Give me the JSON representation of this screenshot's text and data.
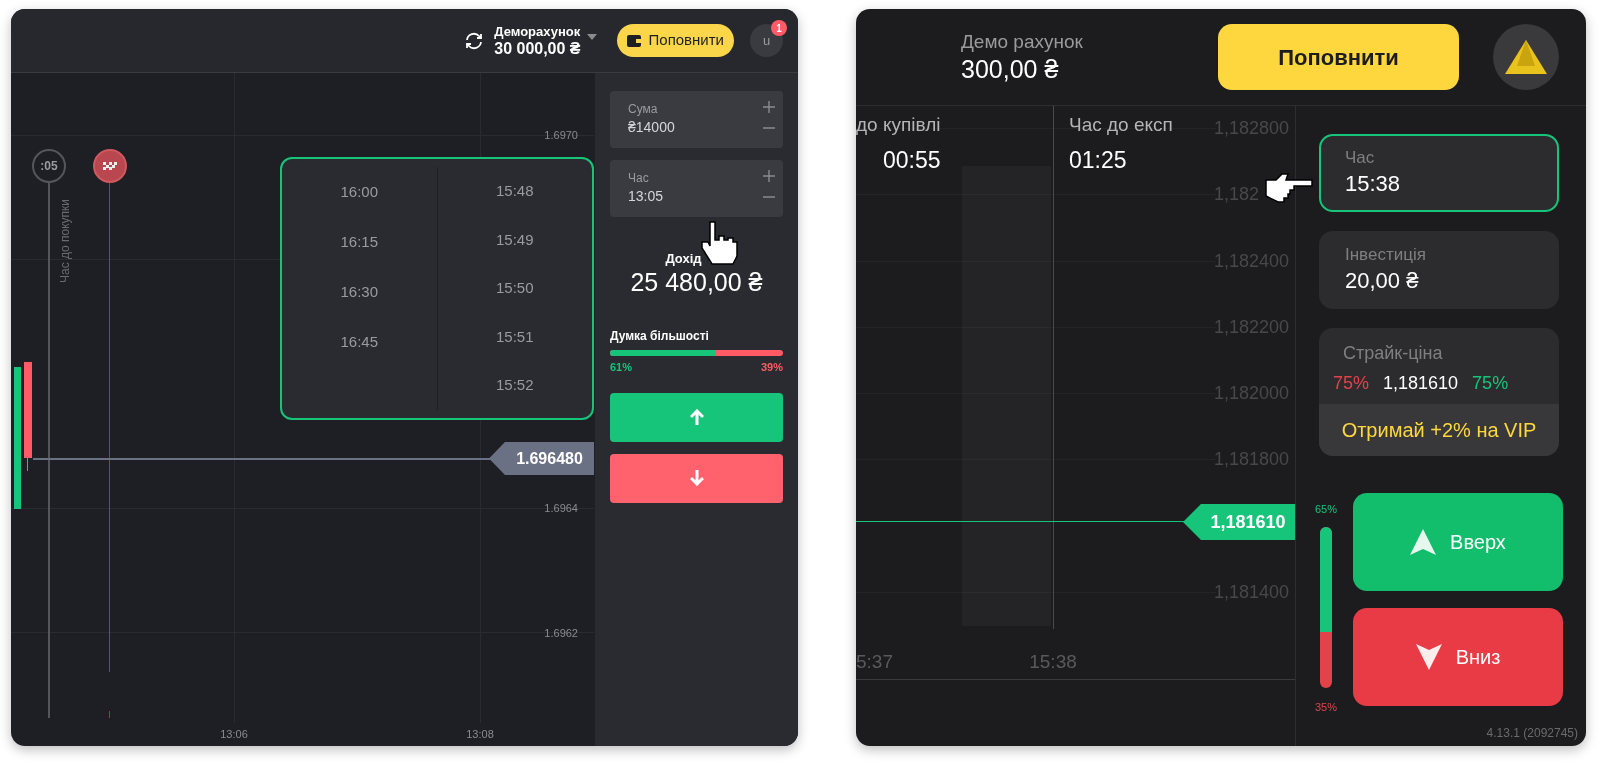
{
  "left_screen": {
    "header": {
      "account_label": "Деморахунок",
      "balance": "30 000,00 ₴",
      "deposit_button": "Поповнити",
      "avatar": "u",
      "notification_count": "1"
    },
    "chart": {
      "y_labels": [
        "1.6970",
        "1.6964",
        "1.6962"
      ],
      "x_labels": [
        "13:06",
        "13:08"
      ],
      "timer": ":05",
      "purchase_line_label": "Час до покупки",
      "price_tag": "1.696480"
    },
    "time_dropdown": {
      "columns": [
        [
          "16:00",
          "16:15",
          "16:30",
          "16:45"
        ],
        [
          "15:48",
          "15:49",
          "15:50",
          "15:51",
          "15:52"
        ]
      ]
    },
    "fields": [
      {
        "label": "Сума",
        "value": "₴14000"
      },
      {
        "label": "Час",
        "value": "13:05"
      }
    ],
    "income": {
      "label": "Дохід",
      "value": "25 480,00 ₴"
    },
    "majority": {
      "label": "Думка більшості",
      "level": 0.61,
      "up": "61%",
      "down": "39%"
    }
  },
  "right_screen": {
    "header": {
      "account_label": "Демо рахунок",
      "balance": "300,00 ₴",
      "deposit_button": "Поповнити"
    },
    "chart": {
      "timers": [
        {
          "label": "до купівлі",
          "value": "00:55"
        },
        {
          "label": "Час до експ",
          "value": "01:25"
        }
      ],
      "y_labels": [
        "1,182800",
        "1,182",
        "1,182400",
        "1,182200",
        "1,182000",
        "1,181800",
        "1,181400"
      ],
      "x_labels": [
        "5:37",
        "15:38"
      ],
      "price_tag": "1,181610"
    },
    "fields": [
      {
        "label": "Час",
        "value": "15:38",
        "focused": true
      },
      {
        "label": "Інвестиція",
        "value": "20,00 ₴",
        "focused": false
      }
    ],
    "strike": {
      "label": "Страйк-ціна",
      "down_payout": "75%",
      "price": "1,181610",
      "up_payout": "75%",
      "promo": "Отримай +2% на VIP"
    },
    "majority": {
      "level": 0.65,
      "up": "65%",
      "down": "35%"
    },
    "buttons": {
      "up": "Вверх",
      "down": "Вниз"
    },
    "version": "4.13.1 (2092745)"
  }
}
